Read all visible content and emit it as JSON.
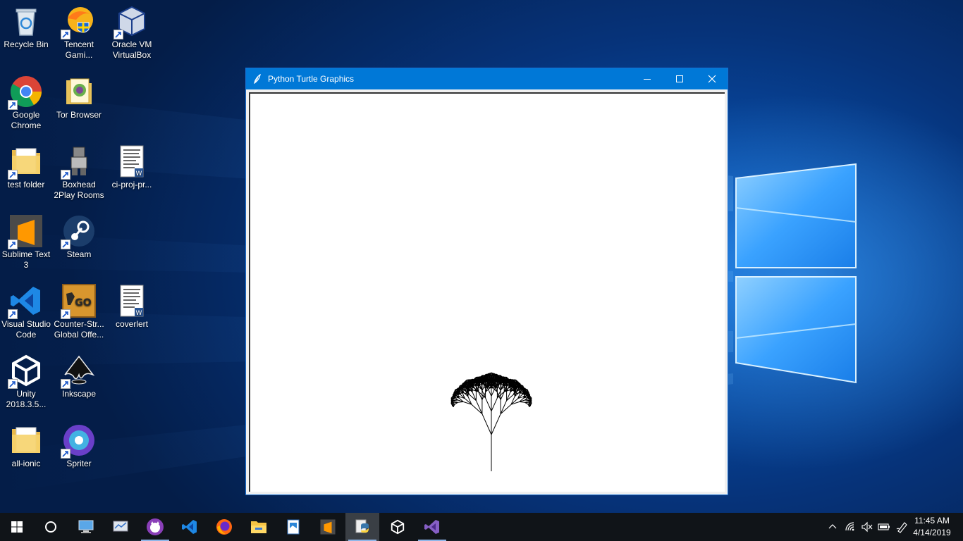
{
  "desktop_icons": [
    {
      "label": "Recycle Bin",
      "icon": "recycle-bin-icon"
    },
    {
      "label": "Tencent Gami...",
      "icon": "tencent-gaming-icon"
    },
    {
      "label": "Oracle VM VirtualBox",
      "icon": "virtualbox-icon"
    },
    {
      "label": "Google Chrome",
      "icon": "chrome-icon"
    },
    {
      "label": "Tor Browser",
      "icon": "tor-browser-icon"
    },
    {
      "label": "test folder",
      "icon": "folder-icon"
    },
    {
      "label": "Boxhead 2Play Rooms",
      "icon": "boxhead-icon"
    },
    {
      "label": "ci-proj-pr...",
      "icon": "word-document-icon"
    },
    {
      "label": "Sublime Text 3",
      "icon": "sublime-text-icon"
    },
    {
      "label": "Steam",
      "icon": "steam-icon"
    },
    {
      "label": "Visual Studio Code",
      "icon": "vscode-icon"
    },
    {
      "label": "Counter-Str... Global Offe...",
      "icon": "csgo-icon"
    },
    {
      "label": "coverlert",
      "icon": "word-document-icon"
    },
    {
      "label": "Unity 2018.3.5...",
      "icon": "unity-icon"
    },
    {
      "label": "Inkscape",
      "icon": "inkscape-icon"
    },
    {
      "label": "all-ionic",
      "icon": "folder-icon"
    },
    {
      "label": "Spriter",
      "icon": "spriter-icon"
    }
  ],
  "window": {
    "title": "Python Turtle Graphics",
    "app_icon": "feather-icon",
    "buttons": {
      "minimize": "minimize-icon",
      "maximize": "maximize-icon",
      "close": "close-icon"
    }
  },
  "taskbar": {
    "start_icon": "windows-start-icon",
    "search_icon": "cortana-circle-icon",
    "apps": [
      {
        "icon": "this-pc-icon",
        "active": false
      },
      {
        "icon": "network-screen-icon",
        "active": false
      },
      {
        "icon": "github-desktop-icon",
        "active": true
      },
      {
        "icon": "vscode-icon",
        "active": false
      },
      {
        "icon": "firefox-icon",
        "active": false
      },
      {
        "icon": "file-explorer-icon",
        "active": false
      },
      {
        "icon": "photos-icon",
        "active": false
      },
      {
        "icon": "sublime-text-icon",
        "active": false
      },
      {
        "icon": "python-icon",
        "active": true,
        "selected": true
      },
      {
        "icon": "unity-icon",
        "active": false
      },
      {
        "icon": "visual-studio-icon",
        "active": true
      }
    ],
    "tray": [
      "chevron-up-icon",
      "wifi-icon",
      "volume-muted-icon",
      "battery-icon",
      "pen-icon"
    ],
    "time": "11:45 AM",
    "date": "4/14/2019"
  },
  "colors": {
    "accent": "#0078d7",
    "taskbar": "#101418",
    "desktop": "#0a4fb0"
  }
}
